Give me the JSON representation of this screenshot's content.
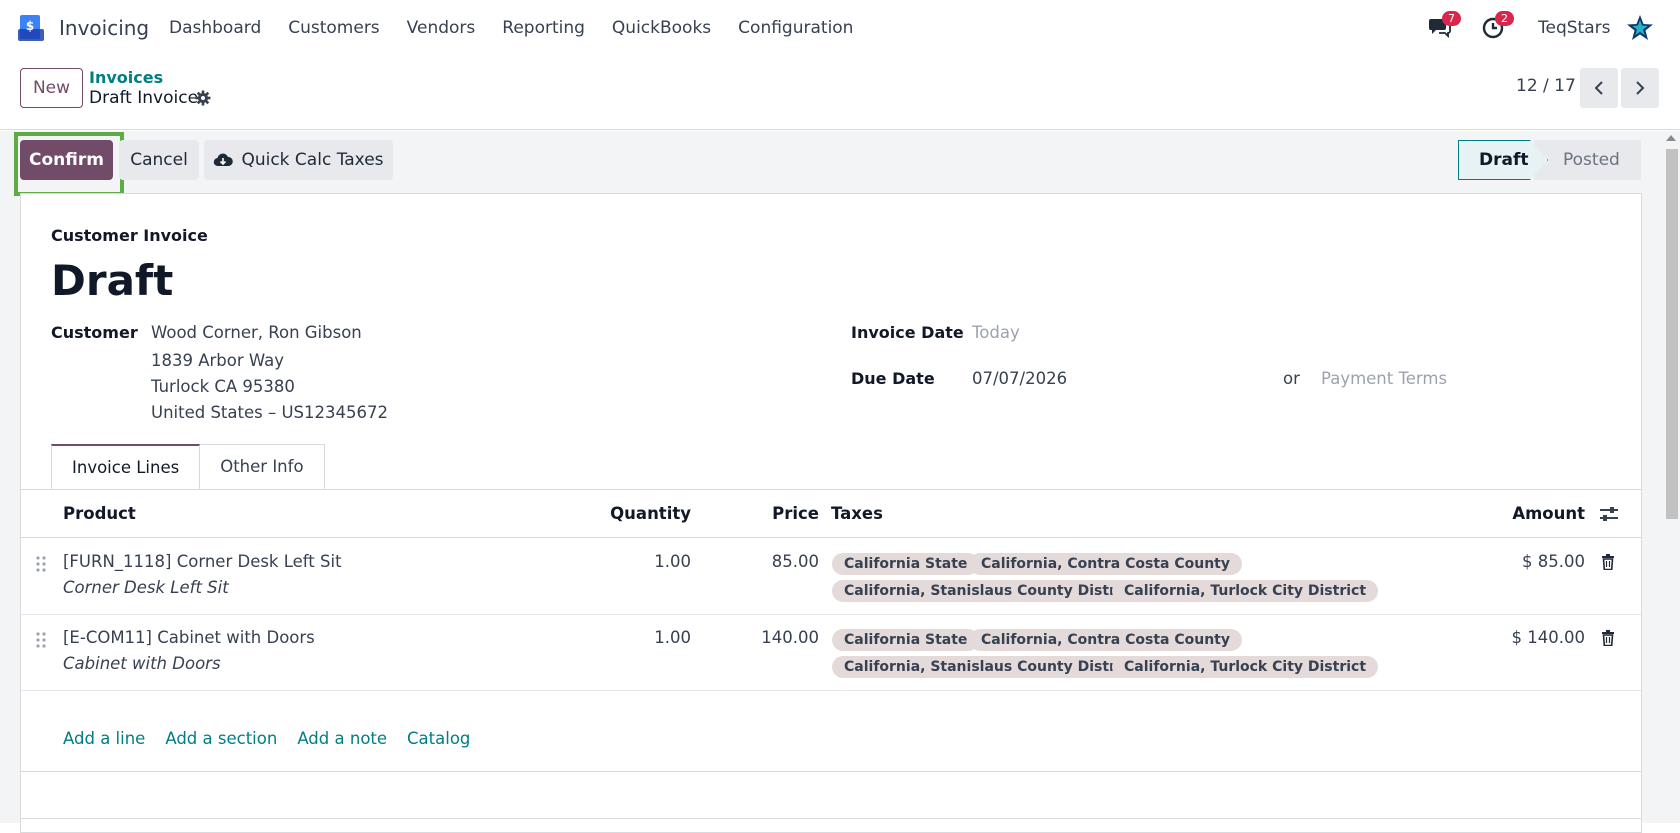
{
  "topbar": {
    "app_name": "Invoicing",
    "menu": [
      "Dashboard",
      "Customers",
      "Vendors",
      "Reporting",
      "QuickBooks",
      "Configuration"
    ],
    "messages_count": "7",
    "activities_count": "2",
    "company": "TeqStars"
  },
  "control_panel": {
    "new_label": "New",
    "breadcrumb_parent": "Invoices",
    "breadcrumb_current": "Draft Invoice",
    "pager": "12 / 17"
  },
  "statusbar": {
    "confirm_label": "Confirm",
    "cancel_label": "Cancel",
    "quick_calc_label": "Quick Calc Taxes",
    "stages": [
      "Draft",
      "Posted"
    ]
  },
  "form": {
    "doc_type": "Customer Invoice",
    "title": "Draft",
    "customer_label": "Customer",
    "customer_name": "Wood Corner, Ron Gibson",
    "customer_address": [
      "1839 Arbor Way",
      "Turlock CA 95380",
      "United States – US12345672"
    ],
    "invoice_date_label": "Invoice Date",
    "invoice_date_placeholder": "Today",
    "due_date_label": "Due Date",
    "due_date": "07/07/2026",
    "or_label": "or",
    "payment_terms_placeholder": "Payment Terms"
  },
  "tabs": [
    "Invoice Lines",
    "Other Info"
  ],
  "lines_table": {
    "headers": [
      "Product",
      "Quantity",
      "Price",
      "Taxes",
      "Amount"
    ],
    "rows": [
      {
        "product": "[FURN_1118] Corner Desk Left Sit",
        "description": "Corner Desk Left Sit",
        "quantity": "1.00",
        "price": "85.00",
        "taxes": [
          "California State",
          "California, Contra Costa County",
          "California, Stanislaus County Distr...",
          "California, Turlock City District"
        ],
        "amount": "$ 85.00"
      },
      {
        "product": "[E-COM11] Cabinet with Doors",
        "description": "Cabinet with Doors",
        "quantity": "1.00",
        "price": "140.00",
        "taxes": [
          "California State",
          "California, Contra Costa County",
          "California, Stanislaus County Distr...",
          "California, Turlock City District"
        ],
        "amount": "$ 140.00"
      }
    ],
    "add_links": [
      "Add a line",
      "Add a section",
      "Add a note",
      "Catalog"
    ]
  },
  "colors": {
    "brand": "#714b67",
    "link": "#017e84",
    "highlight": "#5fab46",
    "badge": "#d9264c"
  },
  "icons": [
    "chat-icon",
    "clock-icon",
    "gear-icon",
    "cloud-download-icon",
    "trash-icon",
    "drag-handle-icon",
    "optional-columns-icon",
    "star-icon"
  ]
}
